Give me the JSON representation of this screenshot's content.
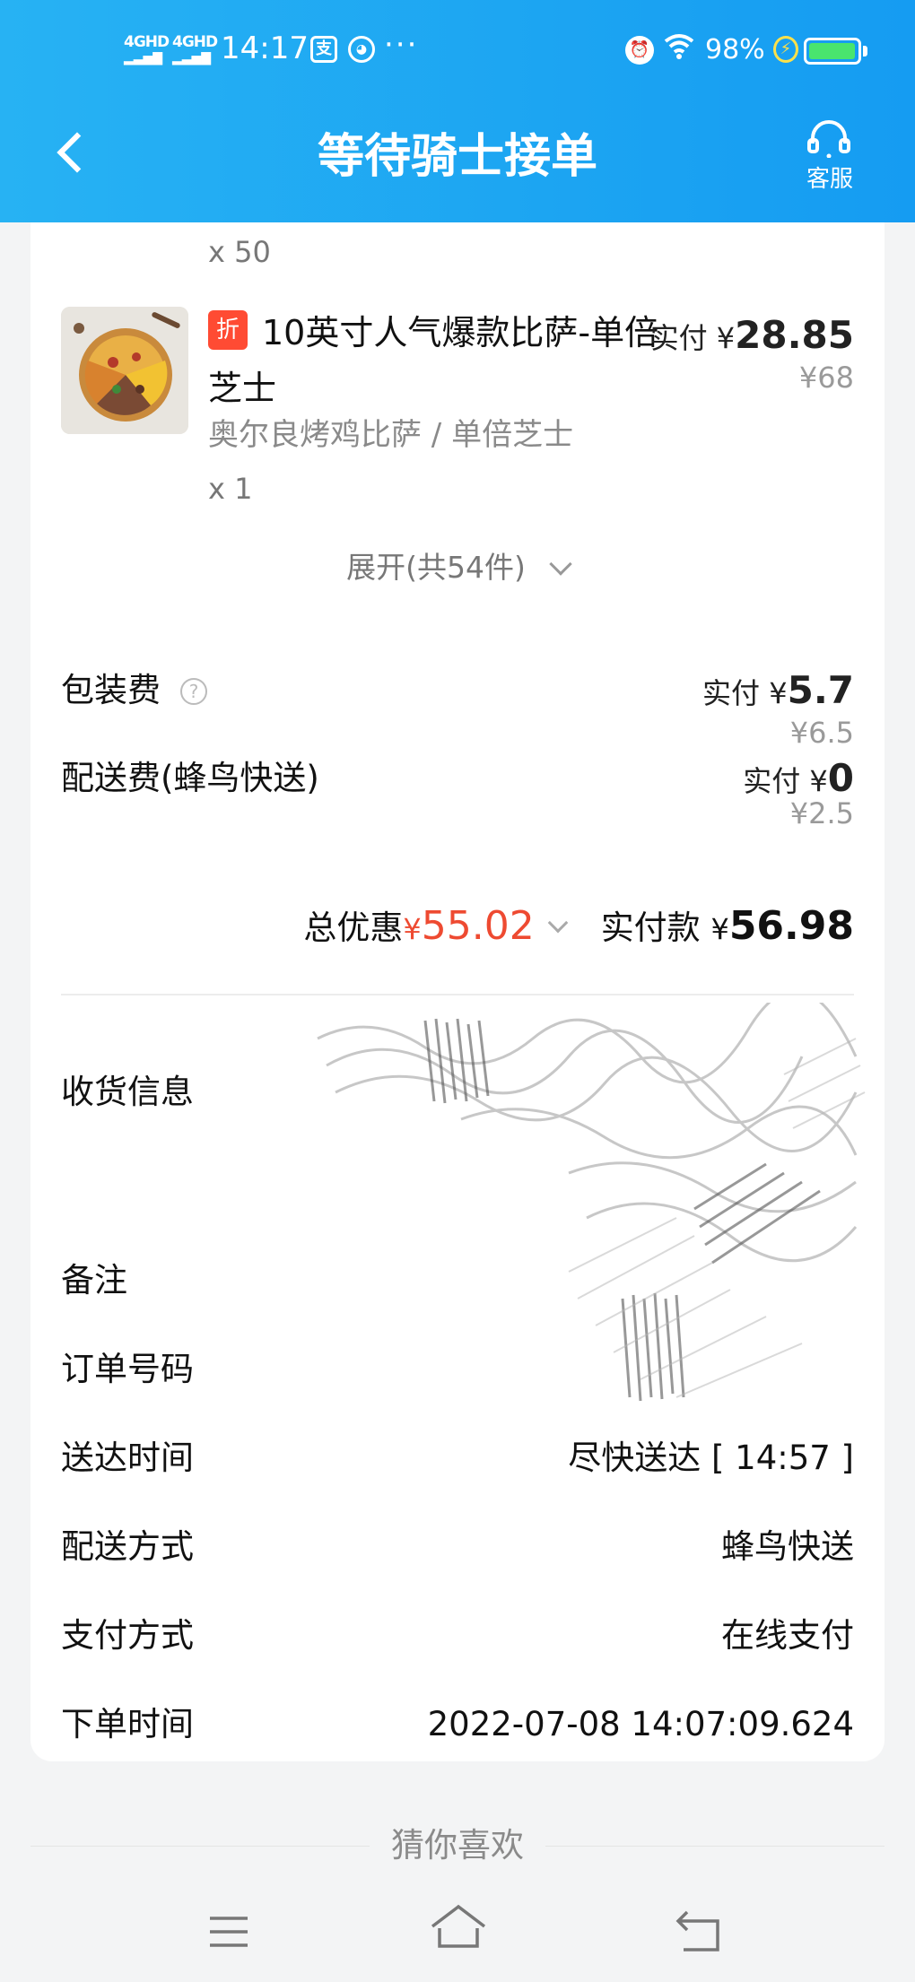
{
  "status_bar": {
    "signal_1": "4GHD",
    "signal_2": "4GHD",
    "time": "14:17",
    "app_icon_1": "支",
    "dots": "···",
    "battery_percent": "98%"
  },
  "header": {
    "title": "等待骑士接单",
    "service_label": "客服"
  },
  "previous_item": {
    "qty": "x 50"
  },
  "item": {
    "badge": "折",
    "name": "10英寸人气爆款比萨-单倍芝士",
    "spec": "奥尔良烤鸡比萨 / 单倍芝士",
    "qty": "x 1",
    "paid_label": "实付 ¥",
    "paid_value": "28.85",
    "original_price": "¥68"
  },
  "expand": {
    "label": "展开(共54件)"
  },
  "fees": {
    "packaging": {
      "label": "包装费",
      "paid_label": "实付 ¥",
      "paid_value": "5.7",
      "original": "¥6.5"
    },
    "delivery": {
      "label": "配送费(蜂鸟快送)",
      "paid_label": "实付 ¥",
      "paid_value": "0",
      "original": "¥2.5"
    }
  },
  "totals": {
    "discount_label": "总优惠",
    "discount_currency": "¥",
    "discount_value": "55.02",
    "paid_label": "实付款",
    "paid_currency": "¥",
    "paid_value": "56.98"
  },
  "info": {
    "address_label": "收货信息",
    "remark_label": "备注",
    "order_no_label": "订单号码",
    "delivery_time_label": "送达时间",
    "delivery_time_value": "尽快送达 [ 14:57 ]",
    "delivery_method_label": "配送方式",
    "delivery_method_value": "蜂鸟快送",
    "payment_label": "支付方式",
    "payment_value": "在线支付",
    "order_time_label": "下单时间",
    "order_time_value": "2022-07-08 14:07:09.624"
  },
  "recommend": {
    "title": "猜你喜欢"
  },
  "colors": {
    "header_blue": "#1aa3f2",
    "accent_red": "#ee4a31",
    "badge_red": "#ff4b33",
    "battery_green": "#49e56e"
  },
  "icons": [
    "back-icon",
    "headset-icon",
    "help-icon",
    "chevron-down-icon",
    "menu-icon",
    "home-icon",
    "back-nav-icon",
    "alarm-icon",
    "wifi-icon",
    "battery-icon"
  ]
}
